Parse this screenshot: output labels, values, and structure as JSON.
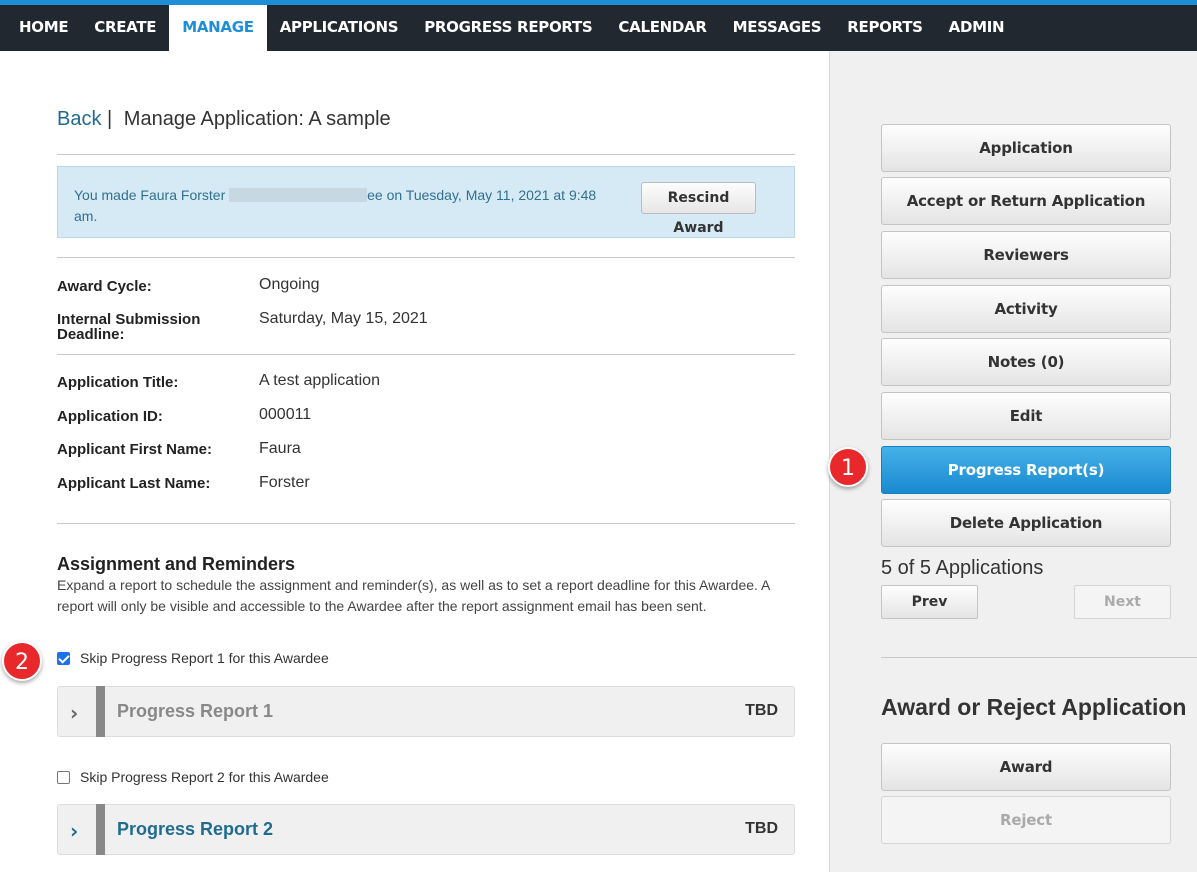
{
  "nav": {
    "items": [
      {
        "label": "HOME"
      },
      {
        "label": "CREATE"
      },
      {
        "label": "MANAGE"
      },
      {
        "label": "APPLICATIONS"
      },
      {
        "label": "PROGRESS REPORTS"
      },
      {
        "label": "CALENDAR"
      },
      {
        "label": "MESSAGES"
      },
      {
        "label": "REPORTS"
      },
      {
        "label": "ADMIN"
      }
    ],
    "active": "MANAGE"
  },
  "breadcrumb": {
    "back": "Back",
    "separator": "|",
    "title": "Manage Application: A sample"
  },
  "notice": {
    "text_before": "You made Faura Forster",
    "text_after": "ee on Tuesday, May 11, 2021 at 9:48 am.",
    "rescind_label": "Rescind Award"
  },
  "award_info": {
    "award_cycle_label": "Award Cycle:",
    "award_cycle_value": "Ongoing",
    "deadline_label": "Internal Submission Deadline:",
    "deadline_value": "Saturday, May 15, 2021"
  },
  "application_info": {
    "title_label": "Application Title:",
    "title_value": "A test application",
    "id_label": "Application ID:",
    "id_value": "000011",
    "first_name_label": "Applicant First Name:",
    "first_name_value": "Faura",
    "last_name_label": "Applicant Last Name:",
    "last_name_value": "Forster"
  },
  "assignment": {
    "title": "Assignment and Reminders",
    "description": "Expand a report to schedule the assignment and reminder(s), as well as to set a report deadline for this Awardee. A report will only be visible and accessible to the Awardee after the report assignment email has been sent."
  },
  "reports": [
    {
      "skip_label": "Skip Progress Report 1 for this Awardee",
      "skipped": true,
      "title": "Progress Report 1",
      "status": "TBD"
    },
    {
      "skip_label": "Skip Progress Report 2 for this Awardee",
      "skipped": false,
      "title": "Progress Report 2",
      "status": "TBD"
    }
  ],
  "sidebar": {
    "buttons": [
      {
        "label": "Application"
      },
      {
        "label": "Accept or Return Application"
      },
      {
        "label": "Reviewers"
      },
      {
        "label": "Activity"
      },
      {
        "label": "Notes (0)"
      },
      {
        "label": "Edit"
      },
      {
        "label": "Progress Report(s)"
      },
      {
        "label": "Delete Application"
      }
    ],
    "count": "5 of 5 Applications",
    "prev": "Prev",
    "next": "Next",
    "award_title": "Award or Reject Application",
    "award": "Award",
    "reject": "Reject"
  },
  "markers": [
    "1",
    "2"
  ],
  "colors": {
    "accent": "#1e8fd6",
    "nav_bg": "#212830",
    "link": "#1f6c8f",
    "marker": "#e8282b"
  }
}
